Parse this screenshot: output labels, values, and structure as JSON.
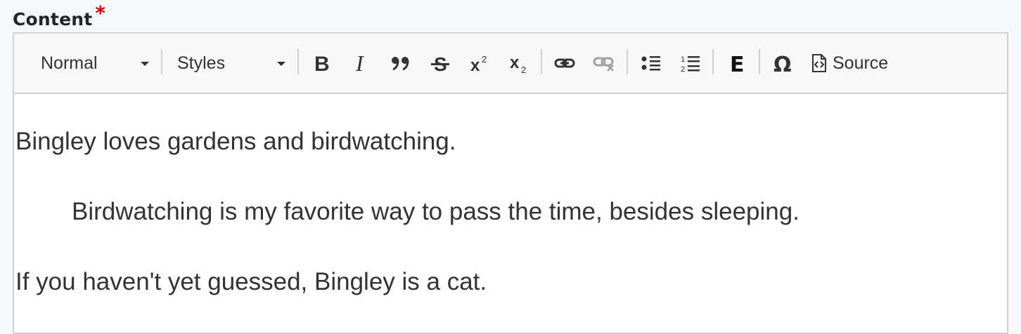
{
  "field": {
    "label": "Content",
    "required_mark": "*"
  },
  "toolbar": {
    "format_dropdown": "Normal",
    "styles_dropdown": "Styles",
    "buttons": {
      "bold": "bold-icon",
      "italic": "italic-icon",
      "blockquote": "blockquote-icon",
      "strikethrough": "strikethrough-icon",
      "superscript": "superscript-icon",
      "subscript": "subscript-icon",
      "link": "link-icon",
      "unlink": "unlink-icon",
      "bulleted_list": "bulleted-list-icon",
      "numbered_list": "numbered-list-icon",
      "entity_embed": "E",
      "special_char": "Ω",
      "source": "Source"
    }
  },
  "content": {
    "paragraphs": [
      "Bingley loves gardens and birdwatching.",
      "Birdwatching is my favorite way to pass the time, besides sleeping.",
      "If you haven't yet guessed, Bingley is a cat."
    ]
  },
  "colors": {
    "required": "#e00000",
    "toolbar_bg": "#f8f8f8",
    "border": "#d1d1d1",
    "text": "#333333",
    "disabled_icon": "#a0a0a0"
  }
}
